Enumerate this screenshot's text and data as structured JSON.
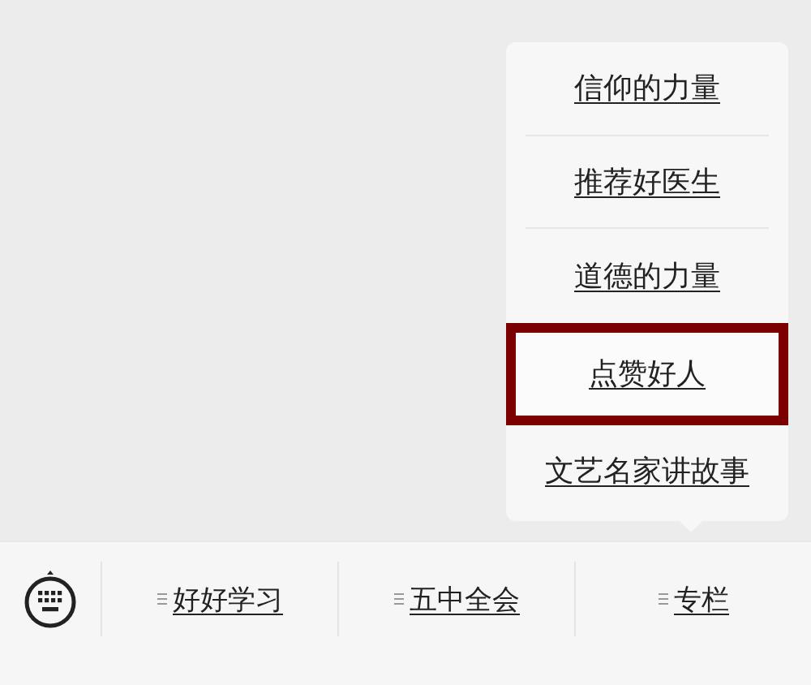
{
  "popup_menu": {
    "items": [
      {
        "label": "信仰的力量",
        "selected": false
      },
      {
        "label": "推荐好医生",
        "selected": false
      },
      {
        "label": "道德的力量",
        "selected": false
      },
      {
        "label": "点赞好人",
        "selected": true
      },
      {
        "label": "文艺名家讲故事",
        "selected": false
      }
    ]
  },
  "bottom_bar": {
    "tabs": [
      {
        "label": "好好学习"
      },
      {
        "label": "五中全会"
      },
      {
        "label": "专栏"
      }
    ]
  }
}
